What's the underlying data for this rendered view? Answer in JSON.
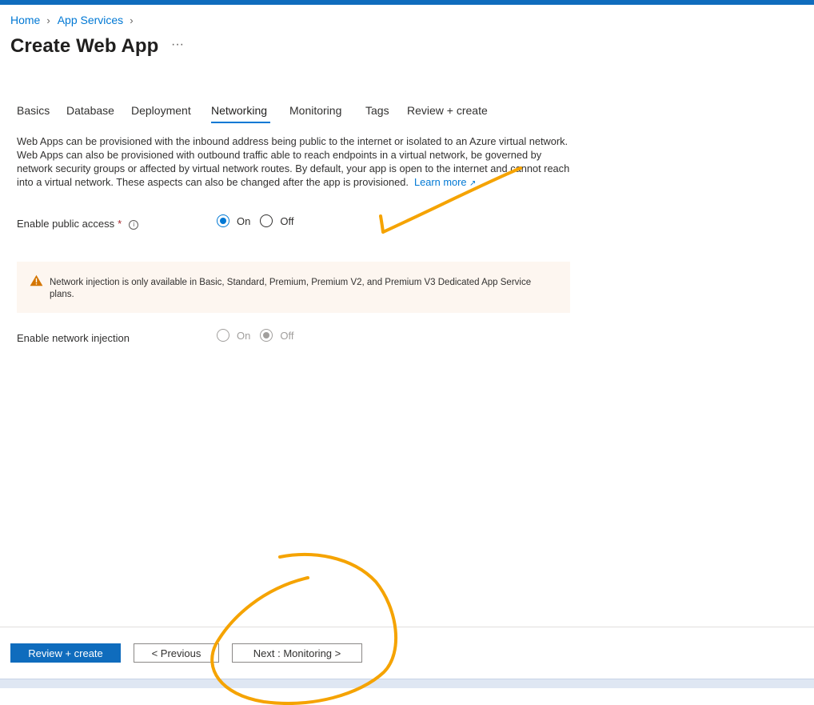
{
  "breadcrumb": [
    "Home",
    "App Services"
  ],
  "page_title": "Create Web App",
  "more_menu": "···",
  "tabs": [
    "Basics",
    "Database",
    "Deployment",
    "Networking",
    "Monitoring",
    "Tags",
    "Review + create"
  ],
  "active_tab": "Networking",
  "description": {
    "text": "Web Apps can be provisioned with the inbound address being public to the internet or isolated to an Azure virtual network. Web Apps can also be provisioned with outbound traffic able to reach endpoints in a virtual network, be governed by network security groups or affected by virtual network routes. By default, your app is open to the internet and cannot reach into a virtual network. These aspects can also be changed after the app is provisioned.",
    "link": "Learn more"
  },
  "public_access": {
    "label": "Enable public access",
    "required": "*",
    "options": [
      "On",
      "Off"
    ],
    "selected": "On"
  },
  "warning": {
    "text": "Network injection is only available in Basic, Standard, Premium, Premium V2, and Premium V3 Dedicated App Service plans."
  },
  "network_injection": {
    "label": "Enable network injection",
    "options": [
      "On",
      "Off"
    ],
    "selected": "Off",
    "disabled": true
  },
  "footer": {
    "review_create": "Review + create",
    "previous": "< Previous",
    "next": "Next : Monitoring >"
  },
  "colors": {
    "accent": "#0078d4",
    "primary_button": "#0f6cbd",
    "annotation": "#f5a300",
    "warning_icon": "#d47500"
  }
}
